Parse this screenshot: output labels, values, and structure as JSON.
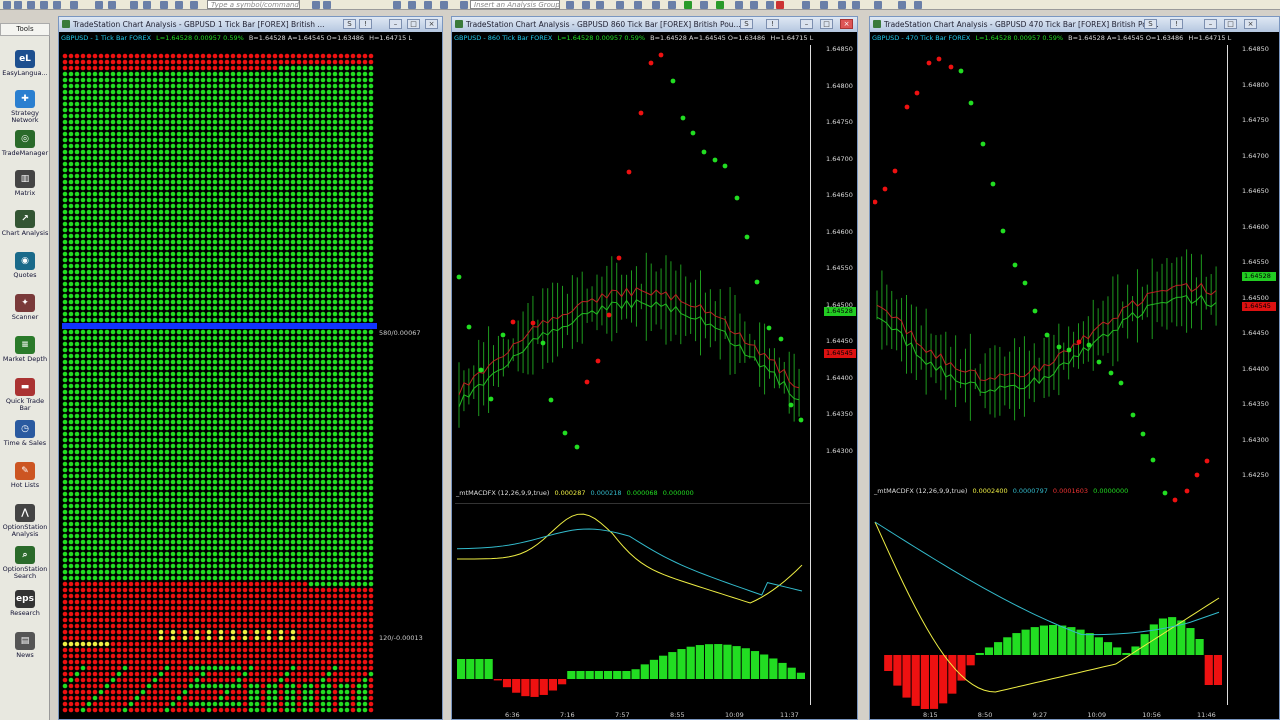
{
  "toolbar": {
    "symbol_placeholder": "Type a symbol/command",
    "analysis_group_placeholder": "Insert an Analysis Group"
  },
  "sidebar": {
    "header": "Tools",
    "items": [
      {
        "label": "EasyLangua...",
        "icon": "easylanguage-icon",
        "glyph": "eL",
        "color": "#1d4f8f"
      },
      {
        "label": "Strategy Network",
        "icon": "strategy-network-icon",
        "glyph": "✚",
        "color": "#2a7fd0"
      },
      {
        "label": "TradeManager",
        "icon": "trademanager-icon",
        "glyph": "◎",
        "color": "#2a6a2a"
      },
      {
        "label": "Matrix",
        "icon": "matrix-icon",
        "glyph": "▥",
        "color": "#444"
      },
      {
        "label": "Chart Analysis",
        "icon": "chart-analysis-icon",
        "glyph": "↗",
        "color": "#335533"
      },
      {
        "label": "Quotes",
        "icon": "quotes-icon",
        "glyph": "◉",
        "color": "#1a6a8a"
      },
      {
        "label": "Scanner",
        "icon": "scanner-icon",
        "glyph": "✦",
        "color": "#7a3a3a"
      },
      {
        "label": "Market Depth",
        "icon": "market-depth-icon",
        "glyph": "≡",
        "color": "#2a7a2a"
      },
      {
        "label": "Quick Trade Bar",
        "icon": "quick-trade-bar-icon",
        "glyph": "▬",
        "color": "#aa3333"
      },
      {
        "label": "Time & Sales",
        "icon": "time-sales-icon",
        "glyph": "◷",
        "color": "#2a5aa0"
      },
      {
        "label": "Hot Lists",
        "icon": "hot-lists-icon",
        "glyph": "✎",
        "color": "#cc5522"
      },
      {
        "label": "OptionStation Analysis",
        "icon": "optionstation-analysis-icon",
        "glyph": "⋀",
        "color": "#444"
      },
      {
        "label": "OptionStation Search",
        "icon": "optionstation-search-icon",
        "glyph": "⌕",
        "color": "#2a6a2a"
      },
      {
        "label": "Research",
        "icon": "research-icon",
        "glyph": "eps",
        "color": "#333"
      },
      {
        "label": "News",
        "icon": "news-icon",
        "glyph": "▤",
        "color": "#555"
      }
    ]
  },
  "windows": [
    {
      "title": "TradeStation Chart Analysis - GBPUSD 1 Tick Bar [FOREX] British ...",
      "info_symbol": "GBPUSD - 1 Tick Bar  FOREX",
      "info_values": "L=1.64528  0.00957  0.59%",
      "info_bid": "B=1.64528  A=1.64545  O=1.63486",
      "info_high": "H=1.64715  L",
      "label_upper": "580/0.00067",
      "label_lower": "120/-0.00013"
    },
    {
      "title": "TradeStation Chart Analysis - GBPUSD 860 Tick Bar [FOREX] British Pou...",
      "info_symbol": "GBPUSD - 860 Tick Bar  FOREX",
      "info_values": "L=1.64528  0.00957  0.59%",
      "info_bid": "B=1.64528  A=1.64545  O=1.63486",
      "info_high": "H=1.64715  L",
      "macd_label": "_mtMACDFX (12,26,9,9,true)",
      "macd_v1": "0.000287",
      "macd_v2": "0.000218",
      "macd_v3": "0.000068",
      "macd_v4": "0.000000",
      "price_ticks": [
        "1.64850",
        "1.64800",
        "1.64750",
        "1.64700",
        "1.64650",
        "1.64600",
        "1.64550",
        "1.64500",
        "1.64450",
        "1.64400",
        "1.64350",
        "1.64300"
      ],
      "last_price": "1.64528",
      "ask_price": "1.64545",
      "time_ticks": [
        "6:36",
        "7:16",
        "7:57",
        "8:55",
        "10:09",
        "11:37"
      ]
    },
    {
      "title": "TradeStation Chart Analysis - GBPUSD 470 Tick Bar [FOREX] British Pou...",
      "info_symbol": "GBPUSD - 470 Tick Bar  FOREX",
      "info_values": "L=1.64528  0.00957  0.59%",
      "info_bid": "B=1.64528  A=1.64545  O=1.63486",
      "info_high": "H=1.64715  L",
      "macd_label": "_mtMACDFX (12,26,9,9,true)",
      "macd_v1": "0.0002400",
      "macd_v2": "0.0000797",
      "macd_v3": "0.0001603",
      "macd_v4": "0.0000000",
      "price_ticks": [
        "1.64850",
        "1.64800",
        "1.64750",
        "1.64700",
        "1.64650",
        "1.64600",
        "1.64550",
        "1.64500",
        "1.64450",
        "1.64400",
        "1.64350",
        "1.64300",
        "1.64250"
      ],
      "last_price": "1.64528",
      "ask_price": "1.64545",
      "time_ticks": [
        "8:15",
        "8:50",
        "9:27",
        "10:09",
        "10:56",
        "11:46"
      ]
    }
  ],
  "colors": {
    "green": "#22dd22",
    "red": "#ee1111",
    "blue": "#1133ff",
    "yellow": "#eeee44",
    "cyan": "#33bbcc"
  }
}
